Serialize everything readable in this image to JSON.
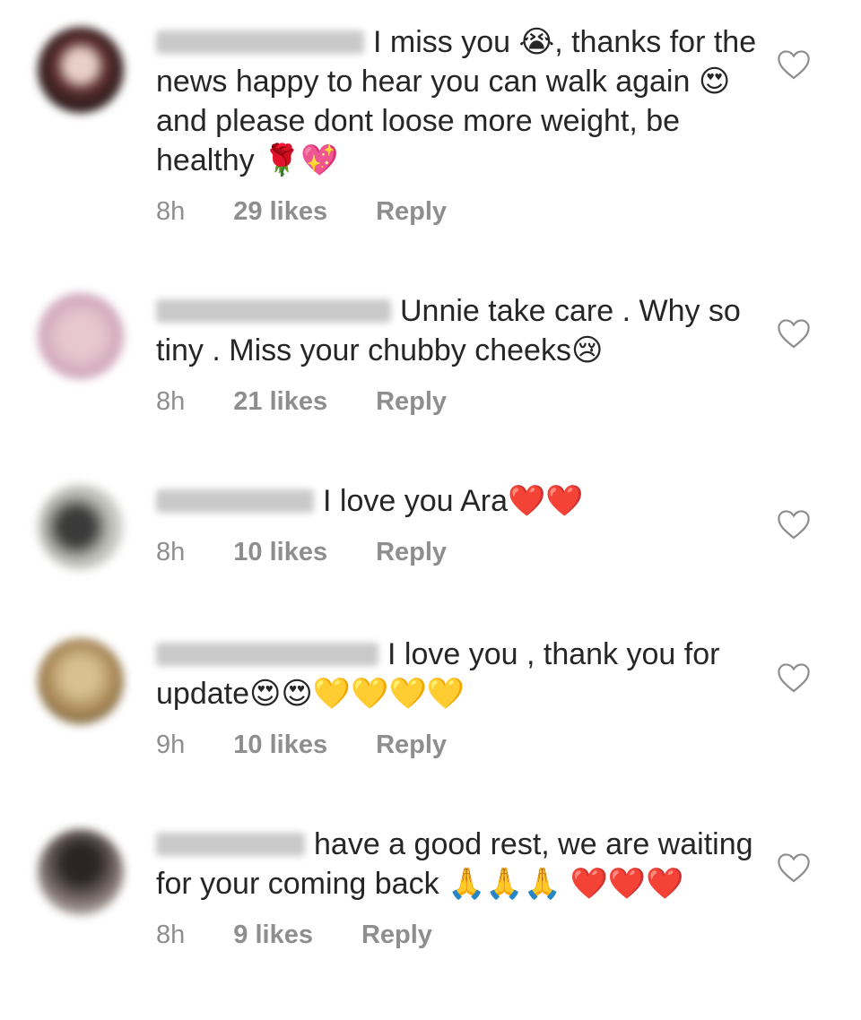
{
  "comments": [
    {
      "username": "taniasan_hani",
      "text": "I miss you 😭, thanks for the news happy to hear you can walk again 😍 and please dont loose more weight,  be healthy 🌹💖",
      "time": "8h",
      "likes": "29 likes",
      "reply": "Reply",
      "avatar_color": "#7a4a4a"
    },
    {
      "username": "mochipeach119",
      "text": "Unnie take care . Why so tiny . Miss your chubby cheeks😢",
      "time": "8h",
      "likes": "21 likes",
      "reply": "Reply",
      "avatar_color": "#c8a8b8"
    },
    {
      "username": "goarel211",
      "text": "I love you Ara❤️❤️",
      "time": "8h",
      "likes": "10 likes",
      "reply": "Reply",
      "avatar_color": "#8a8478"
    },
    {
      "username": "fatemah_p_h_a",
      "text": "I love you , thank you for update😍😍💛💛💛💛",
      "time": "9h",
      "likes": "10 likes",
      "reply": "Reply",
      "avatar_color": "#a89060"
    },
    {
      "username": "ygpxw_ara",
      "text": "have a good rest, we are waiting for your coming back 🙏🙏🙏 ❤️❤️❤️",
      "time": "8h",
      "likes": "9 likes",
      "reply": "Reply",
      "avatar_color": "#5a5050"
    }
  ],
  "colors": {
    "text": "#262626",
    "meta": "#8e8e8e",
    "heart_outline": "#8e8e8e"
  },
  "icons": {
    "like": "heart-outline-icon"
  }
}
